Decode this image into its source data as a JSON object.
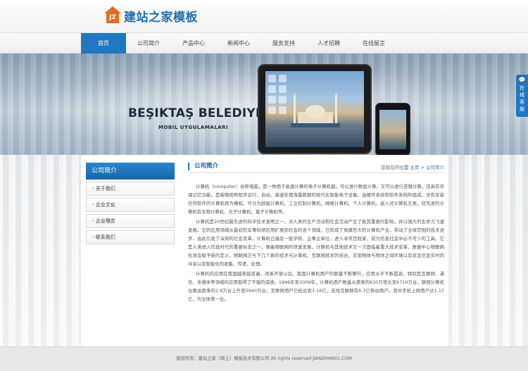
{
  "site": {
    "logo_mark": "JZ",
    "logo_text": "建站之家模板"
  },
  "nav": {
    "items": [
      {
        "label": "首页",
        "active": true
      },
      {
        "label": "公司简介"
      },
      {
        "label": "产品中心"
      },
      {
        "label": "新闻中心"
      },
      {
        "label": "服务支持"
      },
      {
        "label": "人才招聘"
      },
      {
        "label": "在线留言"
      }
    ]
  },
  "banner": {
    "title": "BEŞIKTAŞ BELEDIYESI",
    "subtitle": "MOBIL UYGULAMALARI"
  },
  "sidebar": {
    "heading": "公司简介",
    "items": [
      {
        "label": "- 关于我们"
      },
      {
        "label": "- 企业文化"
      },
      {
        "label": "- 企业理念"
      },
      {
        "label": "- 联系我们"
      }
    ]
  },
  "main": {
    "title": "公司简介",
    "breadcrumb": {
      "prefix": "您现在的位置:",
      "home": "主页",
      "sep": " > ",
      "current": "公司简介"
    },
    "paragraphs": [
      "计算机（computer）俗称电脑，是一种用于高速计算的电子计算机器，可以进行数值计算，又可以进行逻辑计算，还具有存储记忆功能。是能够按照程序运行，自动、高速处理海量数据的现代化智能电子设备。由硬件系统和软件系统所组成，没有安装任何软件的计算机称为裸机。可分为超级计算机、工业控制计算机、网络计算机、个人计算机、嵌入式计算机五类，较先进的计算机有生物计算机、光子计算机、量子计算机等。",
      "计算机是20世纪最先进的科学技术发明之一，对人类的生产活动和社会活动产生了极其重要的影响，并以强大的生命力飞速发展。它的应用领域从最初的军事科研应用扩展到社会的各个领域，已形成了规模巨大的计算机产业，带动了全球范围的技术进步，由此引发了深刻的社会变革，计算机已遍及一般学校、企事业单位，进入寻常百姓家，成为信息社会中必不可少的工具。它是人类进入信息时代的重要标志之一。随着物联网的快速发展，计算机与其他技术又一次面临着重大技术变革，数据中心物联网化将会赋予新的定义，物联网正与下几个新的技术与计算机、互联网技术的结合，实现物体与物体之间环境以及状态信息实时的共享以及智能化的收集、传递、处理。",
      "计算机的应用在我国越来越普遍，改革开放以后，我国计算机用户的数量不断攀升，应用水平不断提高，特别是互联网、通信、多媒体等领域的应用取得了不错的成绩。1996年至2009年，计算机用户数量从原来的630万增长至6710万台，联网计算机台数由原来的2.9万台上升至5940万台。互联网用户已经达到3.16亿，无线互联网有6.7亿移动用户，其中手机上网用户达1.17亿，为全球第一位。"
    ]
  },
  "float_chat": {
    "icon": "💬",
    "text": "在线客服"
  },
  "footer": {
    "text": "版权所有：建站之家（网上）模板技术有限公司 All rights reserved JIANZHAN01.COM"
  },
  "colors": {
    "brand_blue": "#1f78c1",
    "logo_orange": "#e26a1f"
  }
}
